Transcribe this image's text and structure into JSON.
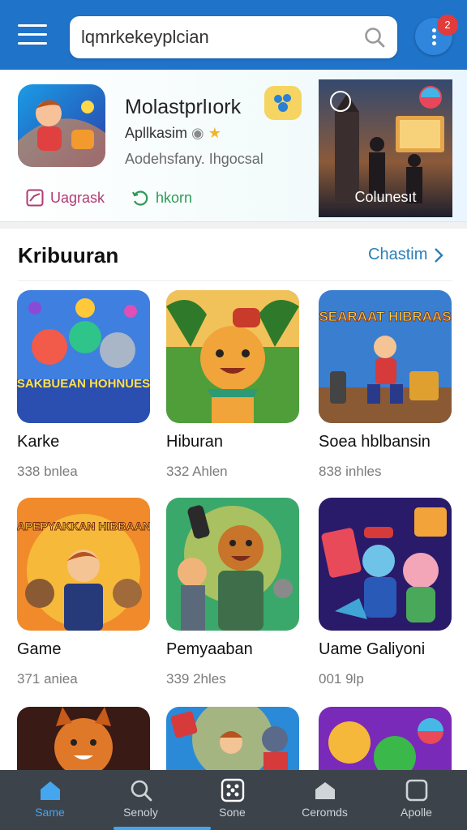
{
  "header": {
    "menu_icon": "hamburger-menu-icon",
    "search_value": "lqmrkekeyplcian",
    "search_icon": "search-icon",
    "notification_count": "2",
    "accent_color": "#1f73c9"
  },
  "featured": {
    "title": "Molastprlıork",
    "subtitle": "Apllkasim",
    "description": "Aodehsfany. Ihgocsal",
    "link_1": "Uagrask",
    "link_2": "hkorn",
    "side_label": "Colunesıt"
  },
  "section": {
    "title": "Kribuuran",
    "link": "Chastim"
  },
  "tiles": [
    {
      "name": "Karke",
      "meta": "338 bnlea",
      "art_text": "SAKBUEAN HOHNUES"
    },
    {
      "name": "Hiburan",
      "meta": "332 Ahlen"
    },
    {
      "name": "Soea hblbansin",
      "meta": "838 inhles",
      "art_text": "SEARAAT HIBRAAS"
    },
    {
      "name": "Game",
      "meta": "371 aniea",
      "art_text": "HAPEPYAKKAN HIBBAANS"
    },
    {
      "name": "Pemyaaban",
      "meta": "339 2hles"
    },
    {
      "name": "Uame Galiyoni",
      "meta": "001 9lp"
    }
  ],
  "bottom_nav": [
    {
      "label": "Same",
      "icon": "home-icon",
      "active": true
    },
    {
      "label": "Senoly",
      "icon": "search-icon",
      "active": false
    },
    {
      "label": "Sone",
      "icon": "dice-icon",
      "active": false
    },
    {
      "label": "Ceromds",
      "icon": "house-icon",
      "active": false
    },
    {
      "label": "Apolle",
      "icon": "square-icon",
      "active": false
    }
  ]
}
